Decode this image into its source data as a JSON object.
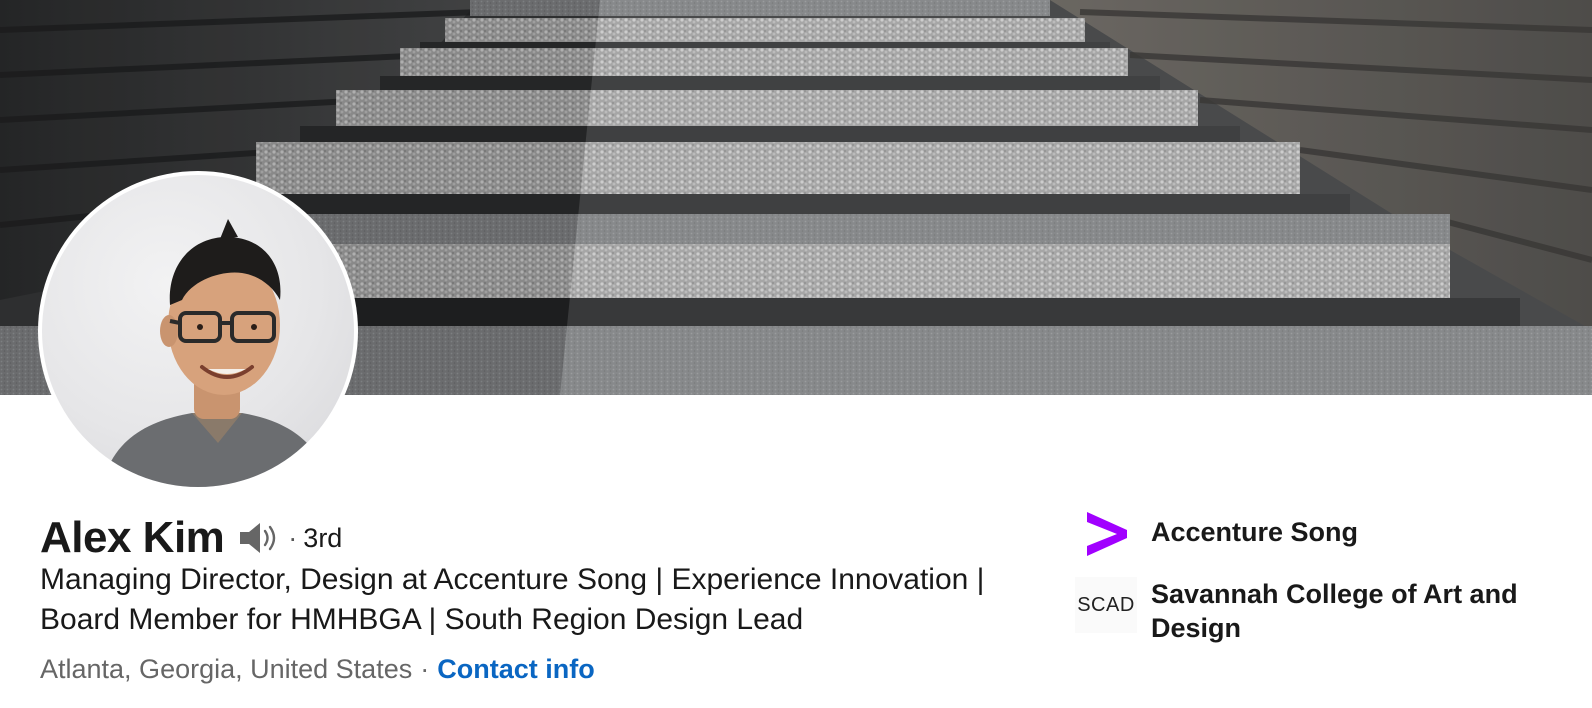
{
  "profile": {
    "name": "Alex Kim",
    "degree_sep": "·",
    "degree": "3rd",
    "headline": "Managing Director, Design at Accenture Song | Experience Innovation | Board Member for HMHBGA | South Region Design Lead",
    "location": "Atlanta, Georgia, United States",
    "location_sep": "·",
    "contact_label": "Contact info"
  },
  "side": {
    "experience": {
      "label": "Accenture Song",
      "logo_icon": "accenture-chevron-icon",
      "logo_color": "#a100ff"
    },
    "education": {
      "label": "Savannah College of Art and Design",
      "logo_text": "SCAD"
    }
  },
  "icons": {
    "pronunciation": "speaker-icon"
  },
  "colors": {
    "link": "#0a66c2",
    "text_primary": "#191919",
    "text_secondary": "#666666",
    "accenture_purple": "#a100ff"
  }
}
